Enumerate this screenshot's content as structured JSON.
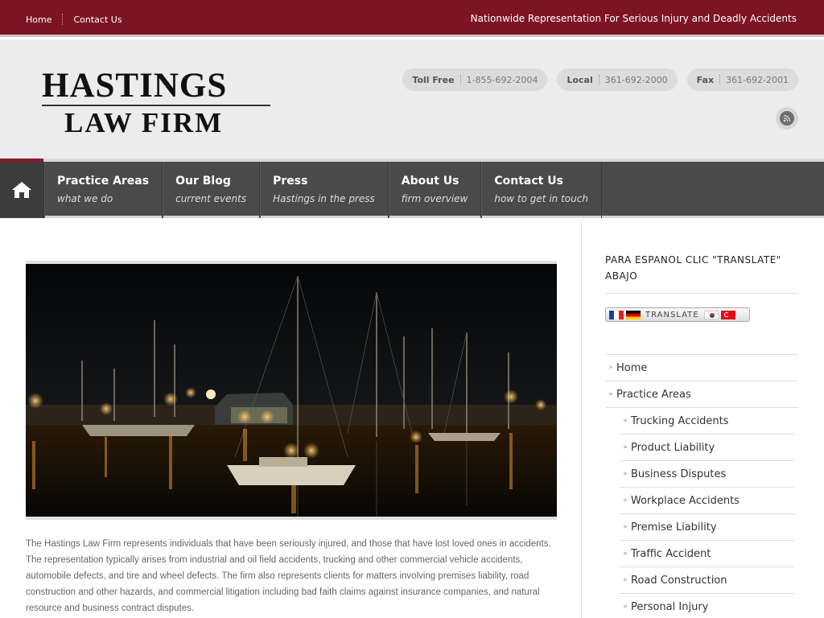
{
  "topbar": {
    "links": [
      "Home",
      "Contact Us"
    ],
    "tagline": "Nationwide Representation For Serious Injury and Deadly Accidents"
  },
  "logo": {
    "line1": "HASTINGS",
    "line2": "LAW FIRM"
  },
  "phones": [
    {
      "label": "Toll Free",
      "number": "1-855-692-2004"
    },
    {
      "label": "Local",
      "number": "361-692-2000"
    },
    {
      "label": "Fax",
      "number": "361-692-2001"
    }
  ],
  "nav": [
    {
      "title": "Practice Areas",
      "sub": "what we do"
    },
    {
      "title": "Our Blog",
      "sub": "current events"
    },
    {
      "title": "Press",
      "sub": "Hastings in the press"
    },
    {
      "title": "About Us",
      "sub": "firm overview"
    },
    {
      "title": "Contact Us",
      "sub": "how to get in touch"
    }
  ],
  "body_text": "The Hastings Law Firm represents individuals that have been seriously injured, and those that have lost loved ones in accidents.   The representation typically arises from industrial and oil field accidents, trucking and other commercial vehicle accidents, automobile defects, and tire and wheel defects.   The firm also represents clients for matters involving premises liability, road construction and other hazards, and commercial litigation including bad faith claims against insurance companies, and natural resource and business contract disputes.",
  "sidebar": {
    "espanol": "PARA ESPANOL CLIC \"TRANSLATE\" ABAJO",
    "translate_label": "TRANSLATE",
    "menu": [
      {
        "label": "Home",
        "level": 0
      },
      {
        "label": "Practice Areas",
        "level": 0
      },
      {
        "label": "Trucking Accidents",
        "level": 1
      },
      {
        "label": "Product Liability",
        "level": 1
      },
      {
        "label": "Business Disputes",
        "level": 1
      },
      {
        "label": "Workplace Accidents",
        "level": 1
      },
      {
        "label": "Premise Liability",
        "level": 1
      },
      {
        "label": "Traffic Accident",
        "level": 1
      },
      {
        "label": "Road Construction",
        "level": 1
      },
      {
        "label": "Personal Injury",
        "level": 1
      }
    ]
  },
  "icons": [
    "home-icon",
    "rss-icon",
    "menu-chevron-icon"
  ],
  "colors": {
    "brand": "#7c1424",
    "nav": "#4a4a4a",
    "header_bg": "#ececec"
  }
}
